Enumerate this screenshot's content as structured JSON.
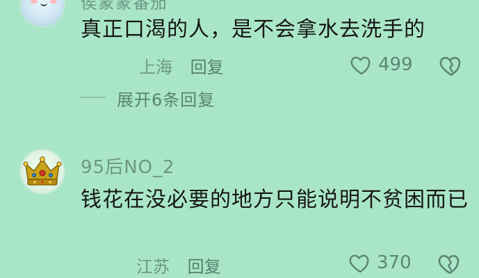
{
  "comments": [
    {
      "author": "侯蒙蒙番茄",
      "text": "真正口渴的人，是不会拿水去洗手的",
      "location": "上海",
      "reply_label": "回复",
      "likes": "499",
      "expand_label": "展开6条回复"
    },
    {
      "author": "95后NO_2",
      "text": "钱花在没必要的地方只能说明不贫困而已",
      "location": "江苏",
      "reply_label": "回复",
      "likes": "370"
    }
  ],
  "icons": {
    "like": "heart-outline-icon",
    "dislike": "broken-heart-outline-icon"
  },
  "colors": {
    "background": "#a9e6c7",
    "primary_text": "#161616",
    "secondary_text": "#6e9784"
  }
}
